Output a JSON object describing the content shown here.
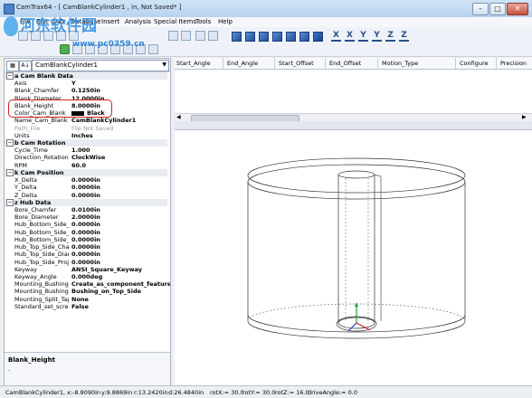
{
  "window": {
    "title": "CamTrax64 - [ CamBlankCylinder1 , in, Not Saved* ]",
    "min_label": "–",
    "max_label": "□",
    "close_label": "✕"
  },
  "menu": [
    "File",
    "Edit",
    "CAD",
    "Database",
    "Insert",
    "Analysis",
    "Special Items",
    "Tools",
    "Help"
  ],
  "toolbar": {
    "axis_buttons": [
      "X",
      "X",
      "Y",
      "Y",
      "Z",
      "Z"
    ]
  },
  "watermark": {
    "line1": "河东软件园",
    "line2": "www.pc0359.cn"
  },
  "left_panel": {
    "sort_buttons": [
      "▦",
      "A↓"
    ],
    "selected_object": "CamBlankCylinder1",
    "categories": [
      {
        "label": "a Cam Blank Data",
        "props": [
          {
            "name": "Axis",
            "value": "Y"
          },
          {
            "name": "Blank_Chamfer",
            "value": "0.1250in"
          },
          {
            "name": "Blank_Diameter",
            "value": "12.0000in"
          },
          {
            "name": "Blank_Height",
            "value": "8.0000in"
          },
          {
            "name": "Color_Cam_Blank",
            "value": "Black"
          },
          {
            "name": "Name_Cam_Blank",
            "value": "CamBlankCylinder1"
          },
          {
            "name": "Path_File",
            "value": "File Not Saved"
          },
          {
            "name": "Units",
            "value": "Inches"
          }
        ]
      },
      {
        "label": "b Cam Rotation",
        "props": [
          {
            "name": "Cycle_Time",
            "value": "1.000"
          },
          {
            "name": "Direction_Rotation",
            "value": "ClockWise"
          },
          {
            "name": "RPM",
            "value": "60.0"
          }
        ]
      },
      {
        "label": "k Cam Position",
        "props": [
          {
            "name": "X_Delta",
            "value": "0.0000in"
          },
          {
            "name": "Y_Delta",
            "value": "0.0000in"
          },
          {
            "name": "Z_Delta",
            "value": "0.0000in"
          }
        ]
      },
      {
        "label": "z Hub Data",
        "props": [
          {
            "name": "Bore_Chamfer",
            "value": "0.0100in"
          },
          {
            "name": "Bore_Diameter",
            "value": "2.0000in"
          },
          {
            "name": "Hub_Bottom_Side_Ch",
            "value": "0.0000in"
          },
          {
            "name": "Hub_Bottom_Side_Dia",
            "value": "0.0000in"
          },
          {
            "name": "Hub_Bottom_Side_Pro",
            "value": "0.0000in"
          },
          {
            "name": "Hub_Top_Side_Cham",
            "value": "0.0000in"
          },
          {
            "name": "Hub_Top_Side_Diame",
            "value": "0.0000in"
          },
          {
            "name": "Hub_Top_Side_Projec",
            "value": "0.0000in"
          },
          {
            "name": "Keyway",
            "value": "ANSI_Square_Keyway"
          },
          {
            "name": "Keyway_Angle",
            "value": "0.000deg"
          },
          {
            "name": "Mounting_Bushing_Me",
            "value": "Create_as_component_feature"
          },
          {
            "name": "Mounting_Bushing_Si",
            "value": "Bushing_on_Top_Side"
          },
          {
            "name": "Mounting_Split_Taper",
            "value": "None"
          },
          {
            "name": "Standard_set_screw",
            "value": "False"
          }
        ]
      }
    ],
    "description_title": "Blank_Height",
    "description_text": "-"
  },
  "grid": {
    "columns": [
      "Start_Angle",
      "End_Angle",
      "Start_Offset",
      "End_Offset",
      "Motion_Type",
      "Configure",
      "Precision"
    ],
    "scroll_left": "◀",
    "scroll_right": "▶"
  },
  "status": {
    "object": "CamBlankCylinder1,",
    "x": "x:-8.8090in",
    "y": "y:9.8869in",
    "r": "r:13.2420in",
    "d": "d:26.4840in",
    "rotX": "rotX:= 30.0",
    "rotY": "rotY:= 30.0",
    "rotZ": "rotZ:= 16.0",
    "drive": "driveAngle:= 0.0"
  }
}
